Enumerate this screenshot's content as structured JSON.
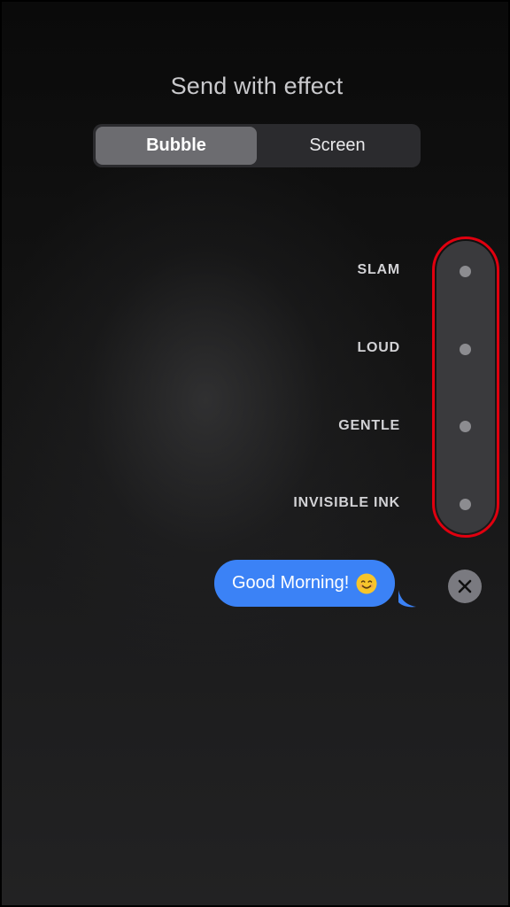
{
  "header": {
    "title": "Send with effect"
  },
  "tabs": [
    {
      "label": "Bubble",
      "selected": true
    },
    {
      "label": "Screen",
      "selected": false
    }
  ],
  "effects": [
    {
      "label": "SLAM"
    },
    {
      "label": "LOUD"
    },
    {
      "label": "GENTLE"
    },
    {
      "label": "INVISIBLE INK"
    }
  ],
  "message": {
    "text": "Good Morning!",
    "emoji": "smiling-face-icon"
  },
  "icons": {
    "close": "close-icon"
  },
  "colors": {
    "bubble_blue": "#3b82f6",
    "highlight_red": "#e0000f",
    "segment_active": "#6c6c70"
  }
}
